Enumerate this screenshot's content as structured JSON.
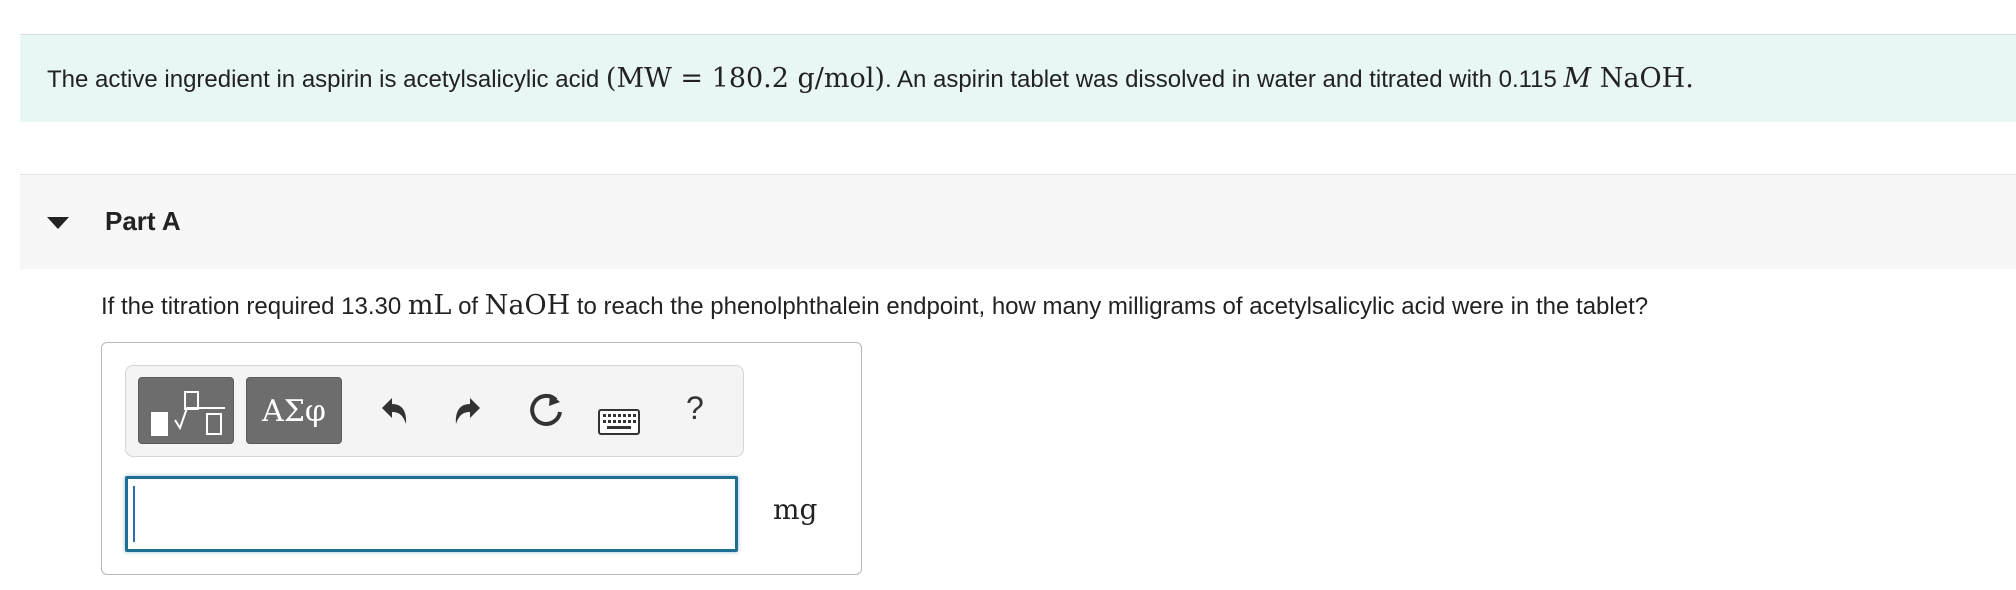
{
  "intro": {
    "text_before": "The active ingredient in aspirin is acetylsalicylic acid ",
    "math_mw": "(MW = 180.2 g/mol)",
    "text_middle": ". An aspirin tablet was dissolved in water and titrated with 0.115 ",
    "math_unit_m": "M",
    "math_naoh": " NaOH",
    "text_end": "."
  },
  "part": {
    "title": "Part A"
  },
  "question": {
    "text_1": "If the titration required 13.30 ",
    "math_ml": "mL",
    "text_2": " of ",
    "math_naoh": "NaOH",
    "text_3": " to reach the phenolphthalein endpoint, how many milligrams of acetylsalicylic acid were in the tablet?"
  },
  "toolbar": {
    "greek_label": "ΑΣφ",
    "help_label": "?"
  },
  "answer": {
    "value": "",
    "unit": "mg"
  },
  "colors": {
    "intro_bg": "#e8f6f6",
    "part_header_bg": "#f7f7f7",
    "toolbar_button_dark": "#6d6d6d",
    "input_focus_border": "#1e6f93"
  },
  "icons": [
    "caret-down-icon",
    "template-icon",
    "undo-icon",
    "redo-icon",
    "reset-icon",
    "keyboard-icon",
    "help-icon"
  ]
}
